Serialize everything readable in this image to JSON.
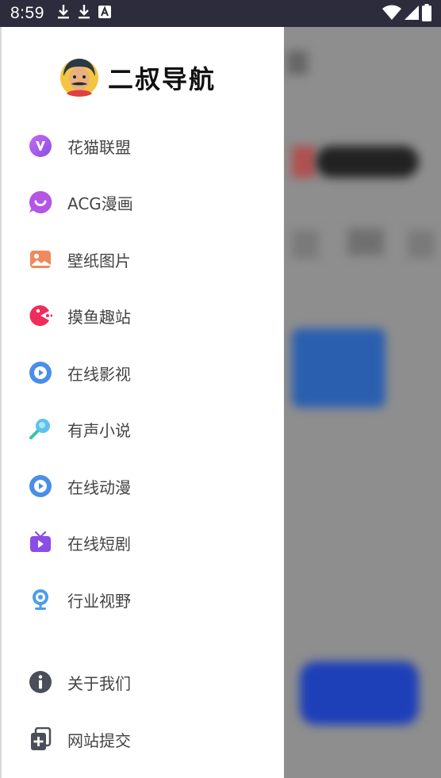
{
  "status_bar": {
    "time": "8:59"
  },
  "drawer": {
    "brand_title": "二叔导航",
    "items": [
      {
        "label": "花猫联盟",
        "icon": "v-badge-icon"
      },
      {
        "label": "ACG漫画",
        "icon": "chat-smile-icon"
      },
      {
        "label": "壁纸图片",
        "icon": "picture-icon"
      },
      {
        "label": "摸鱼趣站",
        "icon": "pacman-icon"
      },
      {
        "label": "在线影视",
        "icon": "play-circle-icon"
      },
      {
        "label": "有声小说",
        "icon": "magnifier-icon"
      },
      {
        "label": "在线动漫",
        "icon": "play-circle-icon"
      },
      {
        "label": "在线短剧",
        "icon": "tv-icon"
      },
      {
        "label": "行业视野",
        "icon": "webcam-icon"
      }
    ],
    "footer_items": [
      {
        "label": "关于我们",
        "icon": "info-icon"
      },
      {
        "label": "网站提交",
        "icon": "add-file-icon"
      }
    ]
  },
  "colors": {
    "status_bar": "#2c2c3c",
    "scrim": "#8e8e8e",
    "drawer_bg": "#ffffff",
    "label_text": "#444444"
  }
}
